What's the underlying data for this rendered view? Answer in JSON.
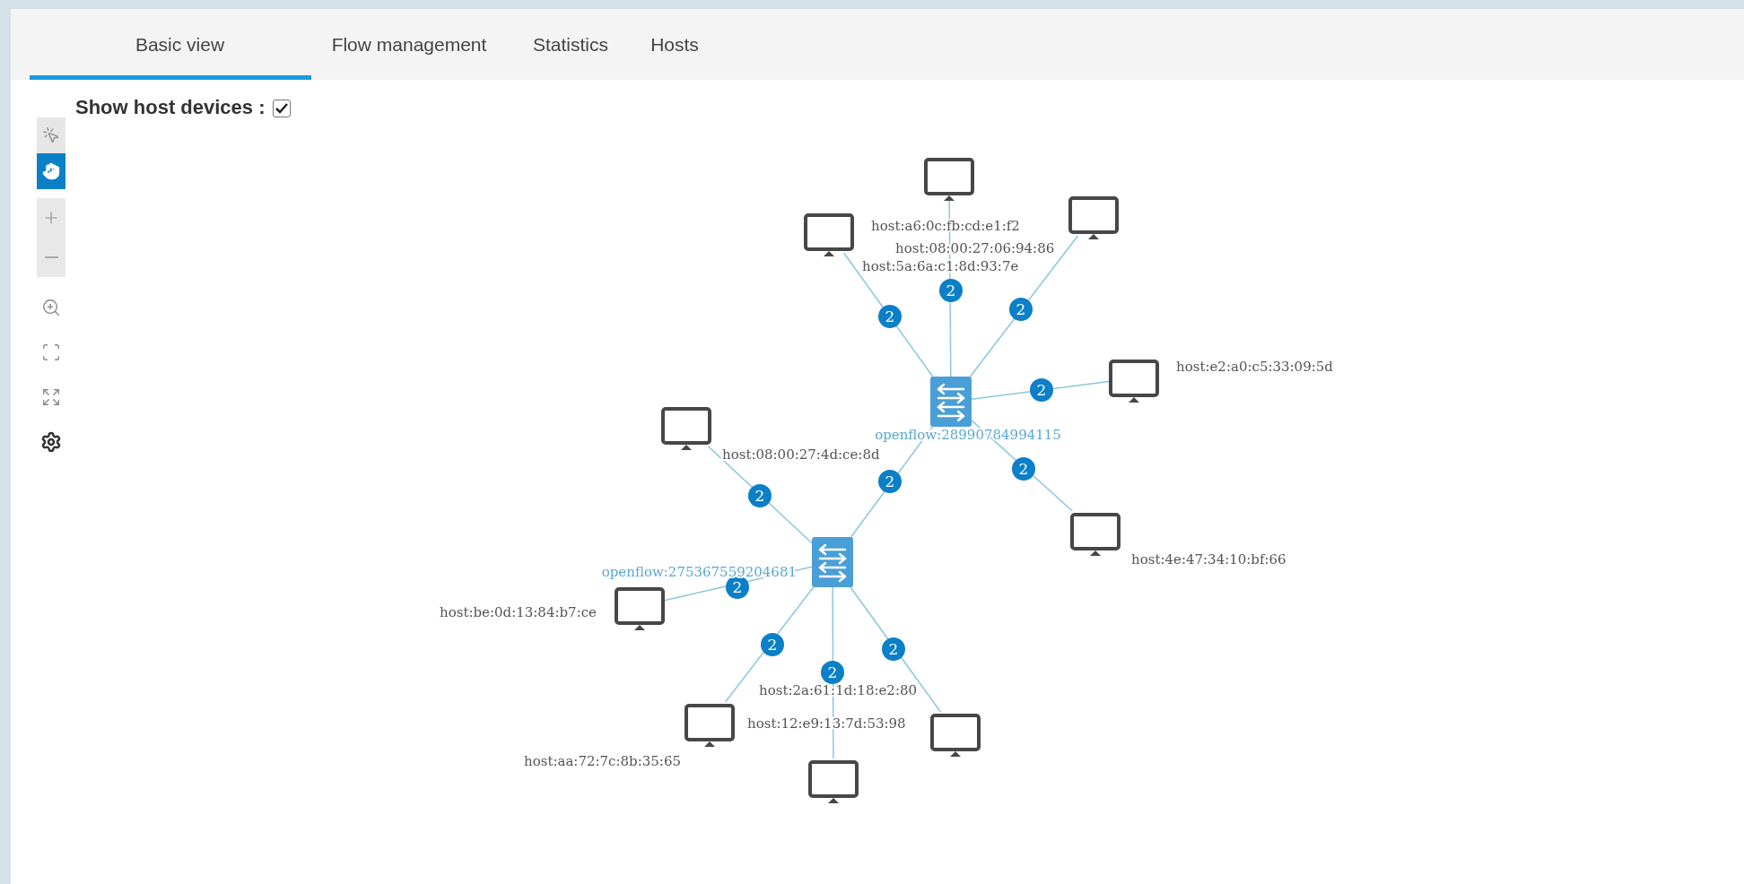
{
  "tabs": [
    {
      "label": "Basic view",
      "selected": true
    },
    {
      "label": "Flow management",
      "selected": false
    },
    {
      "label": "Statistics",
      "selected": false
    },
    {
      "label": "Hosts",
      "selected": false
    }
  ],
  "toolbar": {
    "modes": [
      {
        "kind": "select",
        "selected": false
      },
      {
        "kind": "pan",
        "selected": true
      }
    ],
    "actions": [
      {
        "kind": "zoom_in"
      },
      {
        "kind": "zoom_out"
      },
      {
        "kind": "zoom_region"
      },
      {
        "kind": "fit"
      },
      {
        "kind": "expand"
      },
      {
        "kind": "settings"
      }
    ]
  },
  "show_hosts": {
    "label": "Show host devices :",
    "checked": true
  },
  "topology": {
    "switches": [
      {
        "label": "openflow:28990784994115",
        "hosts": [
          {
            "label": "host:a6:0c:fb:cd:e1:f2",
            "badge": "2"
          },
          {
            "label": "host:08:00:27:06:94:86",
            "badge": "2"
          },
          {
            "label": "host:5a:6a:c1:8d:93:7e",
            "badge": "2"
          },
          {
            "label": "host:e2:a0:c5:33:09:5d",
            "badge": "2"
          },
          {
            "label": "host:4e:47:34:10:bf:66",
            "badge": "2"
          }
        ]
      },
      {
        "label": "openflow:275367559204681",
        "hosts": [
          {
            "label": "host:08:00:27:4d:ce:8d",
            "badge": "2"
          },
          {
            "label": "host:be:0d:13:84:b7:ce",
            "badge": "2"
          },
          {
            "label": "host:2a:61:1d:18:e2:80",
            "badge": "2"
          },
          {
            "label": "host:12:e9:13:7d:53:98",
            "badge": "2"
          },
          {
            "label": "host:aa:72:7c:8b:35:65",
            "badge": "2"
          }
        ]
      }
    ],
    "switch_links": [
      {
        "badge": "2"
      }
    ]
  }
}
